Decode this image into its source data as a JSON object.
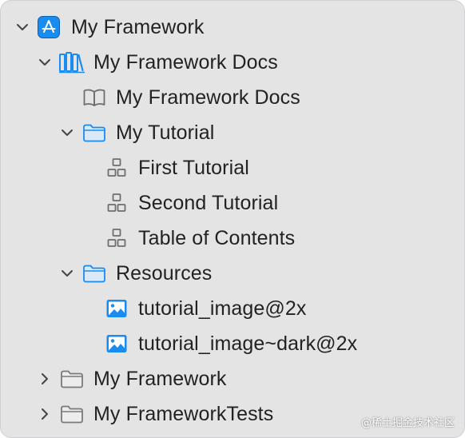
{
  "navigator": {
    "items": [
      {
        "label": "My Framework",
        "icon": "app-store-icon",
        "disclosure": "expanded"
      },
      {
        "label": "My Framework Docs",
        "icon": "documentation-catalog-icon",
        "disclosure": "expanded"
      },
      {
        "label": "My Framework Docs",
        "icon": "book-icon",
        "disclosure": "none"
      },
      {
        "label": "My Tutorial",
        "icon": "folder-icon",
        "disclosure": "expanded"
      },
      {
        "label": "First Tutorial",
        "icon": "tutorial-shapes-icon",
        "disclosure": "none"
      },
      {
        "label": "Second Tutorial",
        "icon": "tutorial-shapes-icon",
        "disclosure": "none"
      },
      {
        "label": "Table of Contents",
        "icon": "tutorial-shapes-icon",
        "disclosure": "none"
      },
      {
        "label": "Resources",
        "icon": "folder-icon",
        "disclosure": "expanded"
      },
      {
        "label": "tutorial_image@2x",
        "icon": "image-icon",
        "disclosure": "none"
      },
      {
        "label": "tutorial_image~dark@2x",
        "icon": "image-icon",
        "disclosure": "none"
      },
      {
        "label": "My Framework",
        "icon": "folder-icon",
        "disclosure": "collapsed"
      },
      {
        "label": "My FrameworkTests",
        "icon": "folder-icon",
        "disclosure": "collapsed"
      }
    ]
  },
  "watermark": "@稀土掘金技术社区",
  "colors": {
    "background": "#e5e4e5",
    "text": "#222222",
    "accent_blue": "#1a8cf0",
    "icon_gray": "#6e6e70",
    "folder_gray": "#7a7a7c"
  }
}
